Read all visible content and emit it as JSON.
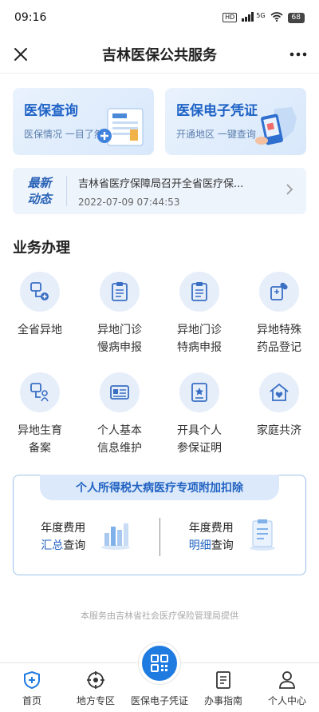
{
  "status": {
    "time": "09:16",
    "hd": "HD",
    "signal": "5G",
    "battery": "68"
  },
  "header": {
    "title": "吉林医保公共服务"
  },
  "cards": [
    {
      "title": "医保查询",
      "subtitle": "医保情况 一目了然"
    },
    {
      "title": "医保电子凭证",
      "subtitle": "开通地区 一键查询"
    }
  ],
  "news": {
    "tag_line1": "最新",
    "tag_line2": "动态",
    "headline": "吉林省医疗保障局召开全省医疗保...",
    "time": "2022-07-09 07:44:53"
  },
  "services": {
    "title": "业务办理",
    "items": [
      {
        "label": "全省异地",
        "icon": "map-plus-icon"
      },
      {
        "label": "异地门诊\n慢病申报",
        "icon": "clipboard-icon"
      },
      {
        "label": "异地门诊\n特病申报",
        "icon": "clipboard-icon"
      },
      {
        "label": "异地特殊\n药品登记",
        "icon": "medicine-icon"
      },
      {
        "label": "异地生育\n备案",
        "icon": "baby-icon"
      },
      {
        "label": "个人基本\n信息维护",
        "icon": "id-card-icon"
      },
      {
        "label": "开具个人\n参保证明",
        "icon": "certificate-icon"
      },
      {
        "label": "家庭共济",
        "icon": "home-heart-icon"
      }
    ]
  },
  "tax": {
    "banner": "个人所得税大病医疗专项附加扣除",
    "left": {
      "line1": "年度费用",
      "highlight": "汇总",
      "suffix": "查询"
    },
    "right": {
      "line1": "年度费用",
      "highlight": "明细",
      "suffix": "查询"
    }
  },
  "footer": {
    "note": "本服务由吉林省社会医疗保险管理局提供"
  },
  "tabs": [
    {
      "label": "首页",
      "active": true
    },
    {
      "label": "地方专区"
    },
    {
      "label": "医保电子凭证"
    },
    {
      "label": "办事指南"
    },
    {
      "label": "个人中心"
    }
  ],
  "colors": {
    "accent": "#1f63c6",
    "tab_active": "#1f7be0",
    "card_bg": "#e9f2fd"
  }
}
